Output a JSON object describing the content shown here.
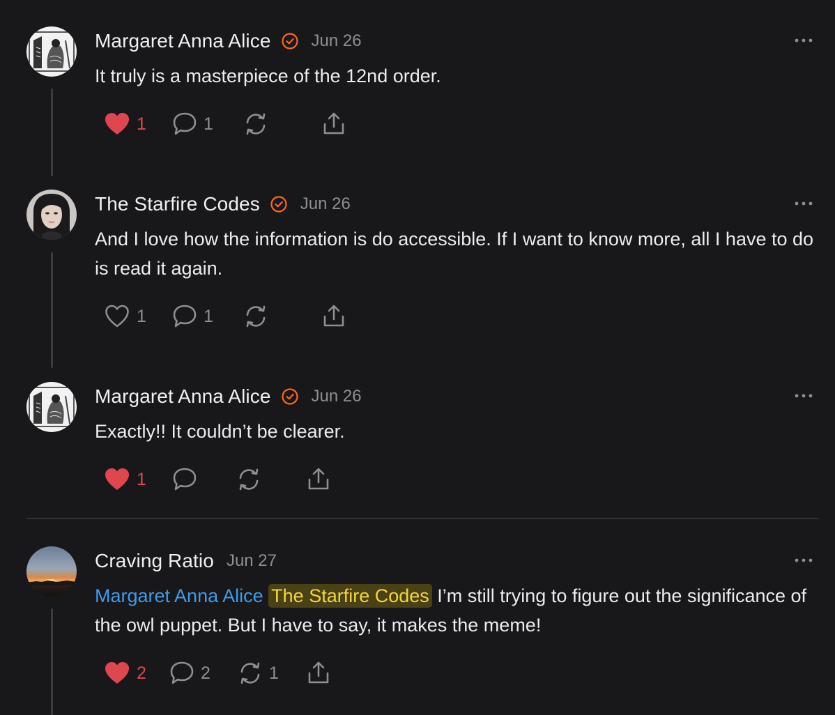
{
  "comments": [
    {
      "author": "Margaret Anna Alice",
      "verified": true,
      "date": "Jun 26",
      "text": "It truly is a masterpiece of the 12nd order.",
      "likes": "1",
      "liked": true,
      "replies": "1",
      "restacks": "",
      "avatar": "engraving-illustration"
    },
    {
      "author": "The Starfire Codes",
      "verified": true,
      "date": "Jun 26",
      "text": "And I love how the information is do accessible. If I want to know more, all I have to do is read it again.",
      "likes": "1",
      "liked": false,
      "replies": "1",
      "restacks": "",
      "avatar": "woman-portrait-photo"
    },
    {
      "author": "Margaret Anna Alice",
      "verified": true,
      "date": "Jun 26",
      "text": "Exactly!! It couldn’t be clearer.",
      "likes": "1",
      "liked": true,
      "replies": "",
      "restacks": "",
      "avatar": "engraving-illustration"
    },
    {
      "author": "Craving Ratio",
      "verified": false,
      "date": "Jun 27",
      "mention_1": "Margaret Anna Alice",
      "mention_2": "The Starfire Codes",
      "text": "I’m still trying to figure out the significance of the owl puppet. But I have to say, it makes the meme!",
      "likes": "2",
      "liked": true,
      "replies": "2",
      "restacks": "1",
      "avatar": "sunset-photo"
    }
  ],
  "icons": {
    "like": "heart-icon",
    "reply": "comment-bubble-icon",
    "restack": "restack-icon",
    "share": "share-icon",
    "more": "more-horizontal-icon",
    "verified": "verified-check-icon"
  },
  "colors": {
    "background": "#18181a",
    "accent_orange": "#ff6719",
    "liked_red": "#e0464f",
    "mention_blue": "#3d9be9",
    "highlight_yellow": "#f5d53c",
    "muted": "#8e8e93"
  }
}
